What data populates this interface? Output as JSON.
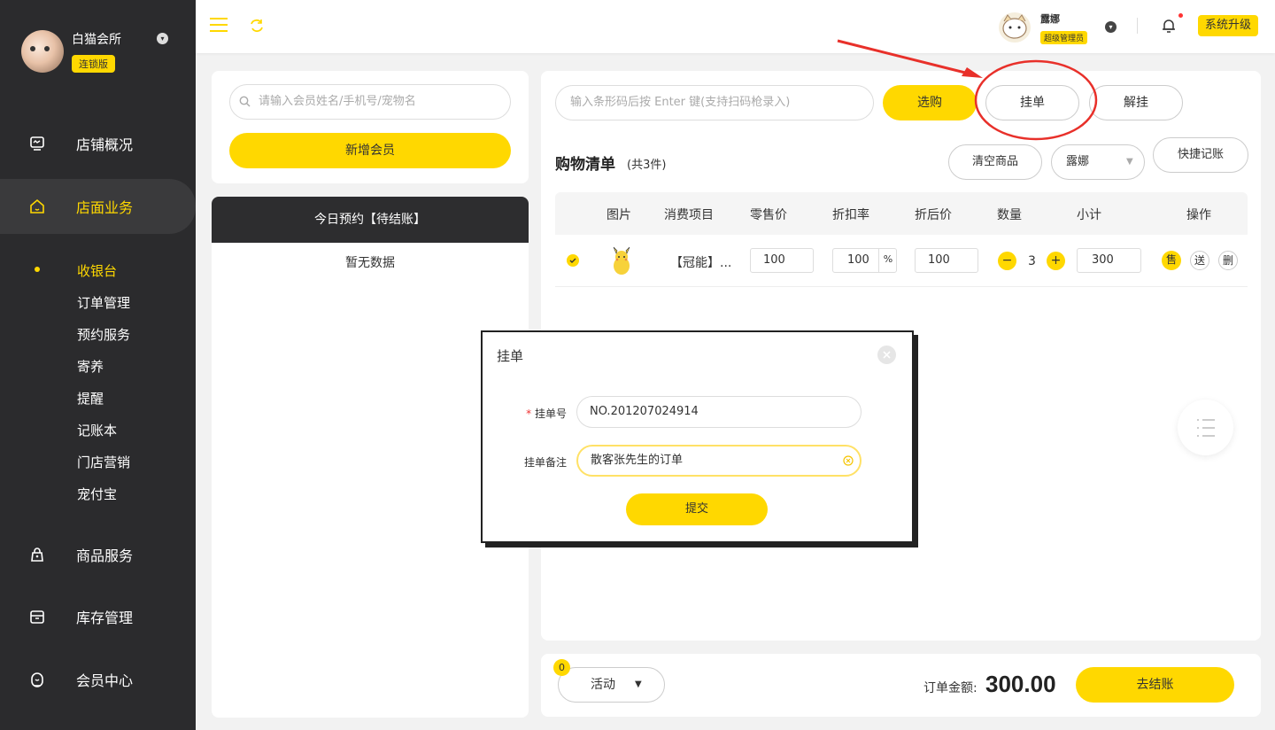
{
  "sidebar": {
    "brand_name": "白猫会所",
    "brand_badge": "连锁版",
    "nav": [
      {
        "label": "店铺概况",
        "icon": "monitor-icon"
      },
      {
        "label": "店面业务",
        "icon": "home-icon"
      },
      {
        "label": "商品服务",
        "icon": "bag-icon"
      },
      {
        "label": "库存管理",
        "icon": "box-icon"
      },
      {
        "label": "会员中心",
        "icon": "member-icon"
      }
    ],
    "sub_items": [
      "收银台",
      "订单管理",
      "预约服务",
      "寄养",
      "提醒",
      "记账本",
      "门店营销",
      "宠付宝"
    ]
  },
  "topbar": {
    "user_name": "露娜",
    "user_role": "超级管理员",
    "upgrade_label": "系统升级"
  },
  "member": {
    "search_placeholder": "请输入会员姓名/手机号/宠物名",
    "add_member_label": "新增会员",
    "appointment_title": "今日预约【待结账】",
    "appointment_empty": "暂无数据"
  },
  "cart": {
    "barcode_placeholder": "输入条形码后按 Enter 键(支持扫码枪录入)",
    "select_label": "选购",
    "hang_label": "挂单",
    "unhang_label": "解挂",
    "title": "购物清单",
    "count": "(共3件)",
    "clear_label": "清空商品",
    "staff_label": "露娜",
    "quick_label": "快捷记账",
    "headers": [
      "图片",
      "消费项目",
      "零售价",
      "折扣率",
      "折后价",
      "数量",
      "小计",
      "操作"
    ],
    "row": {
      "item": "【冠能】...",
      "retail": "100",
      "discount": "100",
      "discount_unit": "%",
      "after": "100",
      "qty": "3",
      "subtotal": "300",
      "op_sell": "售",
      "op_gift": "送",
      "op_delete": "删"
    }
  },
  "bottom": {
    "activity_count": "0",
    "activity_label": "活动",
    "total_label": "订单金额:",
    "total_value": "300.00",
    "checkout_label": "去结账"
  },
  "dialog": {
    "title": "挂单",
    "order_no_label": "挂单号",
    "order_no_value": "NO.201207024914",
    "note_label": "挂单备注",
    "note_value": "散客张先生的订单",
    "submit_label": "提交"
  },
  "colors": {
    "accent": "#ffd800",
    "sidebar": "#2b2b2d",
    "annotation": "#e8302a"
  }
}
